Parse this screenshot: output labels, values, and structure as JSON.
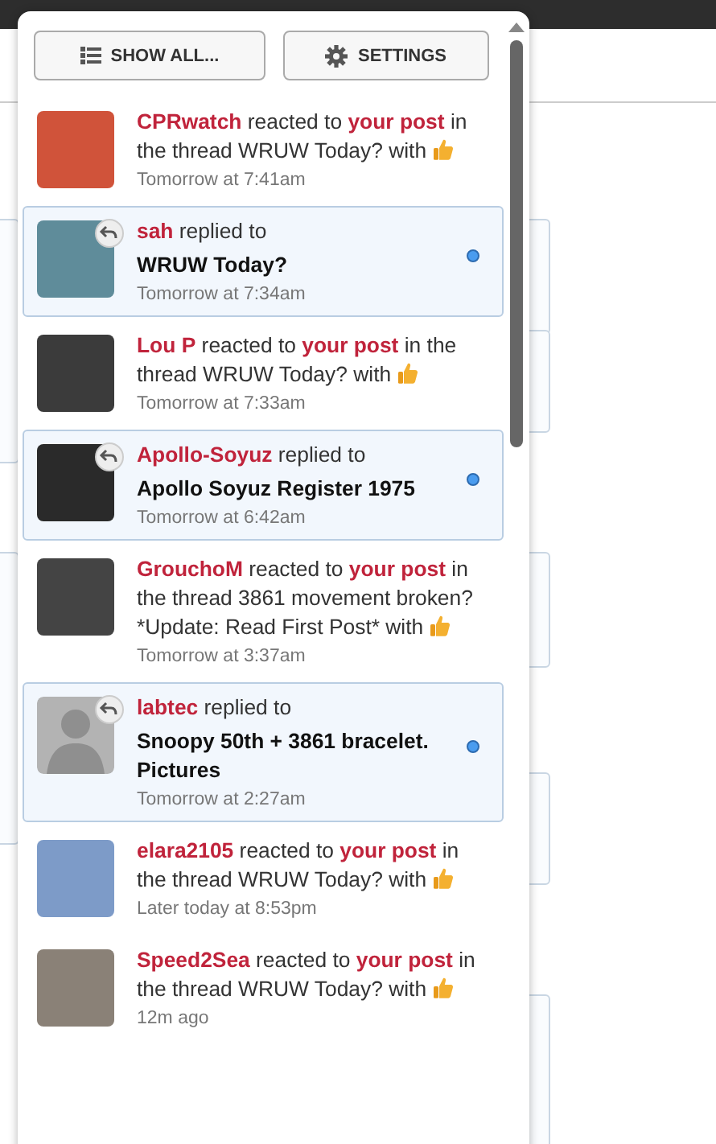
{
  "toolbar": {
    "buttons": [
      {
        "label": "SHOW ALL..."
      },
      {
        "label": "SETTINGS"
      }
    ]
  },
  "notifications": [
    {
      "kind": "reaction",
      "actor": "CPRwatch",
      "action": "reacted to",
      "link": "your post",
      "rest": "in the thread WRUW Today? with",
      "time": "Tomorrow at 7:41am",
      "unread": false
    },
    {
      "kind": "reply",
      "actor": "sah",
      "action": "replied to",
      "title": "WRUW Today?",
      "time": "Tomorrow at 7:34am",
      "unread": true
    },
    {
      "kind": "reaction",
      "actor": "Lou P",
      "action": "reacted to",
      "link": "your post",
      "rest": "in the thread WRUW Today? with",
      "time": "Tomorrow at 7:33am",
      "unread": false
    },
    {
      "kind": "reply",
      "actor": "Apollo-Soyuz",
      "action": "replied to",
      "title": "Apollo Soyuz Register 1975",
      "time": "Tomorrow at 6:42am",
      "unread": true
    },
    {
      "kind": "reaction",
      "actor": "GrouchoM",
      "action": "reacted to",
      "link": "your post",
      "rest": "in the thread 3861 movement broken? *Update: Read First Post* with",
      "time": "Tomorrow at 3:37am",
      "unread": false
    },
    {
      "kind": "reply",
      "actor": "labtec",
      "action": "replied to",
      "title": "Snoopy 50th + 3861 bracelet. Pictures",
      "time": "Tomorrow at 2:27am",
      "unread": true
    },
    {
      "kind": "reaction",
      "actor": "elara2105",
      "action": "reacted to",
      "link": "your post",
      "rest": "in the thread WRUW Today? with",
      "time": "Later today at 8:53pm",
      "unread": false
    },
    {
      "kind": "reaction",
      "actor": "Speed2Sea",
      "action": "reacted to",
      "link": "your post",
      "rest": "in the thread WRUW Today? with",
      "time": "12m ago",
      "unread": false
    }
  ]
}
